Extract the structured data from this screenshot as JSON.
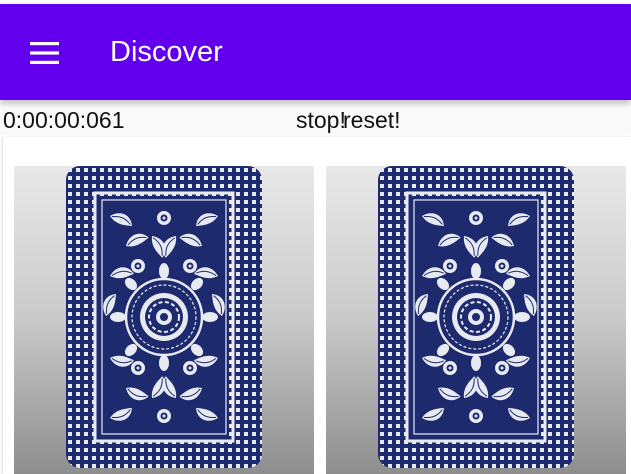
{
  "colors": {
    "appbar": "#6200EE",
    "card_navy": "#1E2A6E",
    "card_pattern": "#E8EAF2"
  },
  "appbar": {
    "title": "Discover",
    "menu_icon": "hamburger-menu-icon"
  },
  "controls": {
    "timer": "0:00:00:061",
    "stop_label": "stop!",
    "reset_label": "reset!"
  },
  "cards": [
    {
      "face": "back",
      "icon": "card-back-pattern"
    },
    {
      "face": "back",
      "icon": "card-back-pattern"
    }
  ]
}
